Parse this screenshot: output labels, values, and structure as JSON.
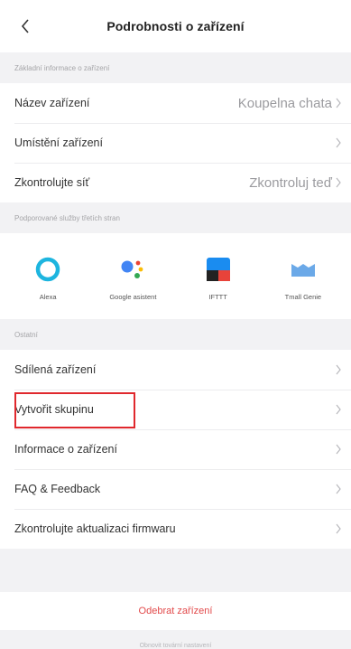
{
  "header": {
    "title": "Podrobnosti o zařízení"
  },
  "basic": {
    "section_label": "Základní informace o zařízení",
    "rows": [
      {
        "label": "Název zařízení",
        "value": "Koupelna chata"
      },
      {
        "label": "Umístění zařízení",
        "value": ""
      },
      {
        "label": "Zkontrolujte síť",
        "value": "Zkontroluj teď"
      }
    ]
  },
  "services": {
    "section_label": "Podporované služby třetích stran",
    "items": [
      {
        "label": "Alexa",
        "icon": "alexa-icon"
      },
      {
        "label": "Google asistent",
        "icon": "google-assistant-icon"
      },
      {
        "label": "IFTTT",
        "icon": "ifttt-icon"
      },
      {
        "label": "Tmall Genie",
        "icon": "tmall-genie-icon"
      }
    ]
  },
  "others": {
    "section_label": "Ostatní",
    "rows": [
      {
        "label": "Sdílená zařízení"
      },
      {
        "label": "Vytvořit skupinu"
      },
      {
        "label": "Informace o zařízení"
      },
      {
        "label": "FAQ & Feedback"
      },
      {
        "label": "Zkontrolujte aktualizaci firmwaru"
      }
    ]
  },
  "remove_label": "Odebrat zařízení",
  "footer_note": "Obnovit tovární nastavení",
  "colors": {
    "highlight": "#e0282d",
    "remove": "#e2494a",
    "alexa": "#1db5df",
    "ifttt_blue": "#1a8cf0",
    "tmall": "#6ba9e8"
  }
}
